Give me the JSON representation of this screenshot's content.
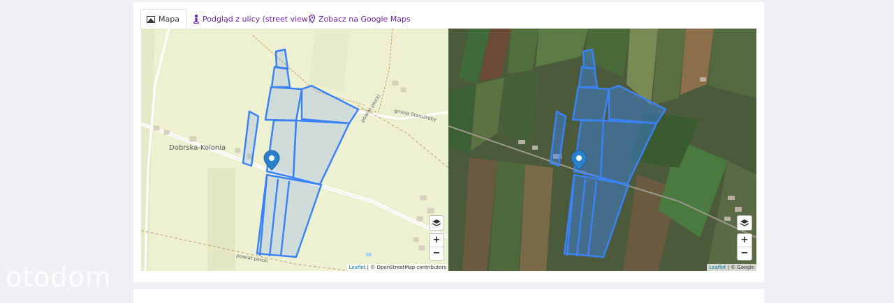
{
  "tabs": [
    {
      "label": "Mapa",
      "icon": "map-icon",
      "active": true
    },
    {
      "label": "Podgląd z ulicy (street view)",
      "icon": "street-view-icon",
      "active": false
    },
    {
      "label": "Zobacz na Google Maps",
      "icon": "map-pin-icon",
      "active": false
    }
  ],
  "map_left": {
    "labels": {
      "village": "Dobrska-Kolonia",
      "road_top": "powiat płocki",
      "road_gmina": "gmina Staroźreby",
      "road_bottom": "powiat płocki"
    },
    "attribution": {
      "link": "Leaflet",
      "sep": " | ",
      "text": "© OpenStreetMap contributors"
    },
    "zoom_in": "+",
    "zoom_out": "−"
  },
  "map_right": {
    "attribution": {
      "link": "Leaflet",
      "sep": " | ",
      "text": "© Google"
    },
    "zoom_in": "+",
    "zoom_out": "−"
  },
  "watermark": "otodom",
  "colors": {
    "parcel": "#3b82f6",
    "tab_link": "#6b21a8"
  }
}
